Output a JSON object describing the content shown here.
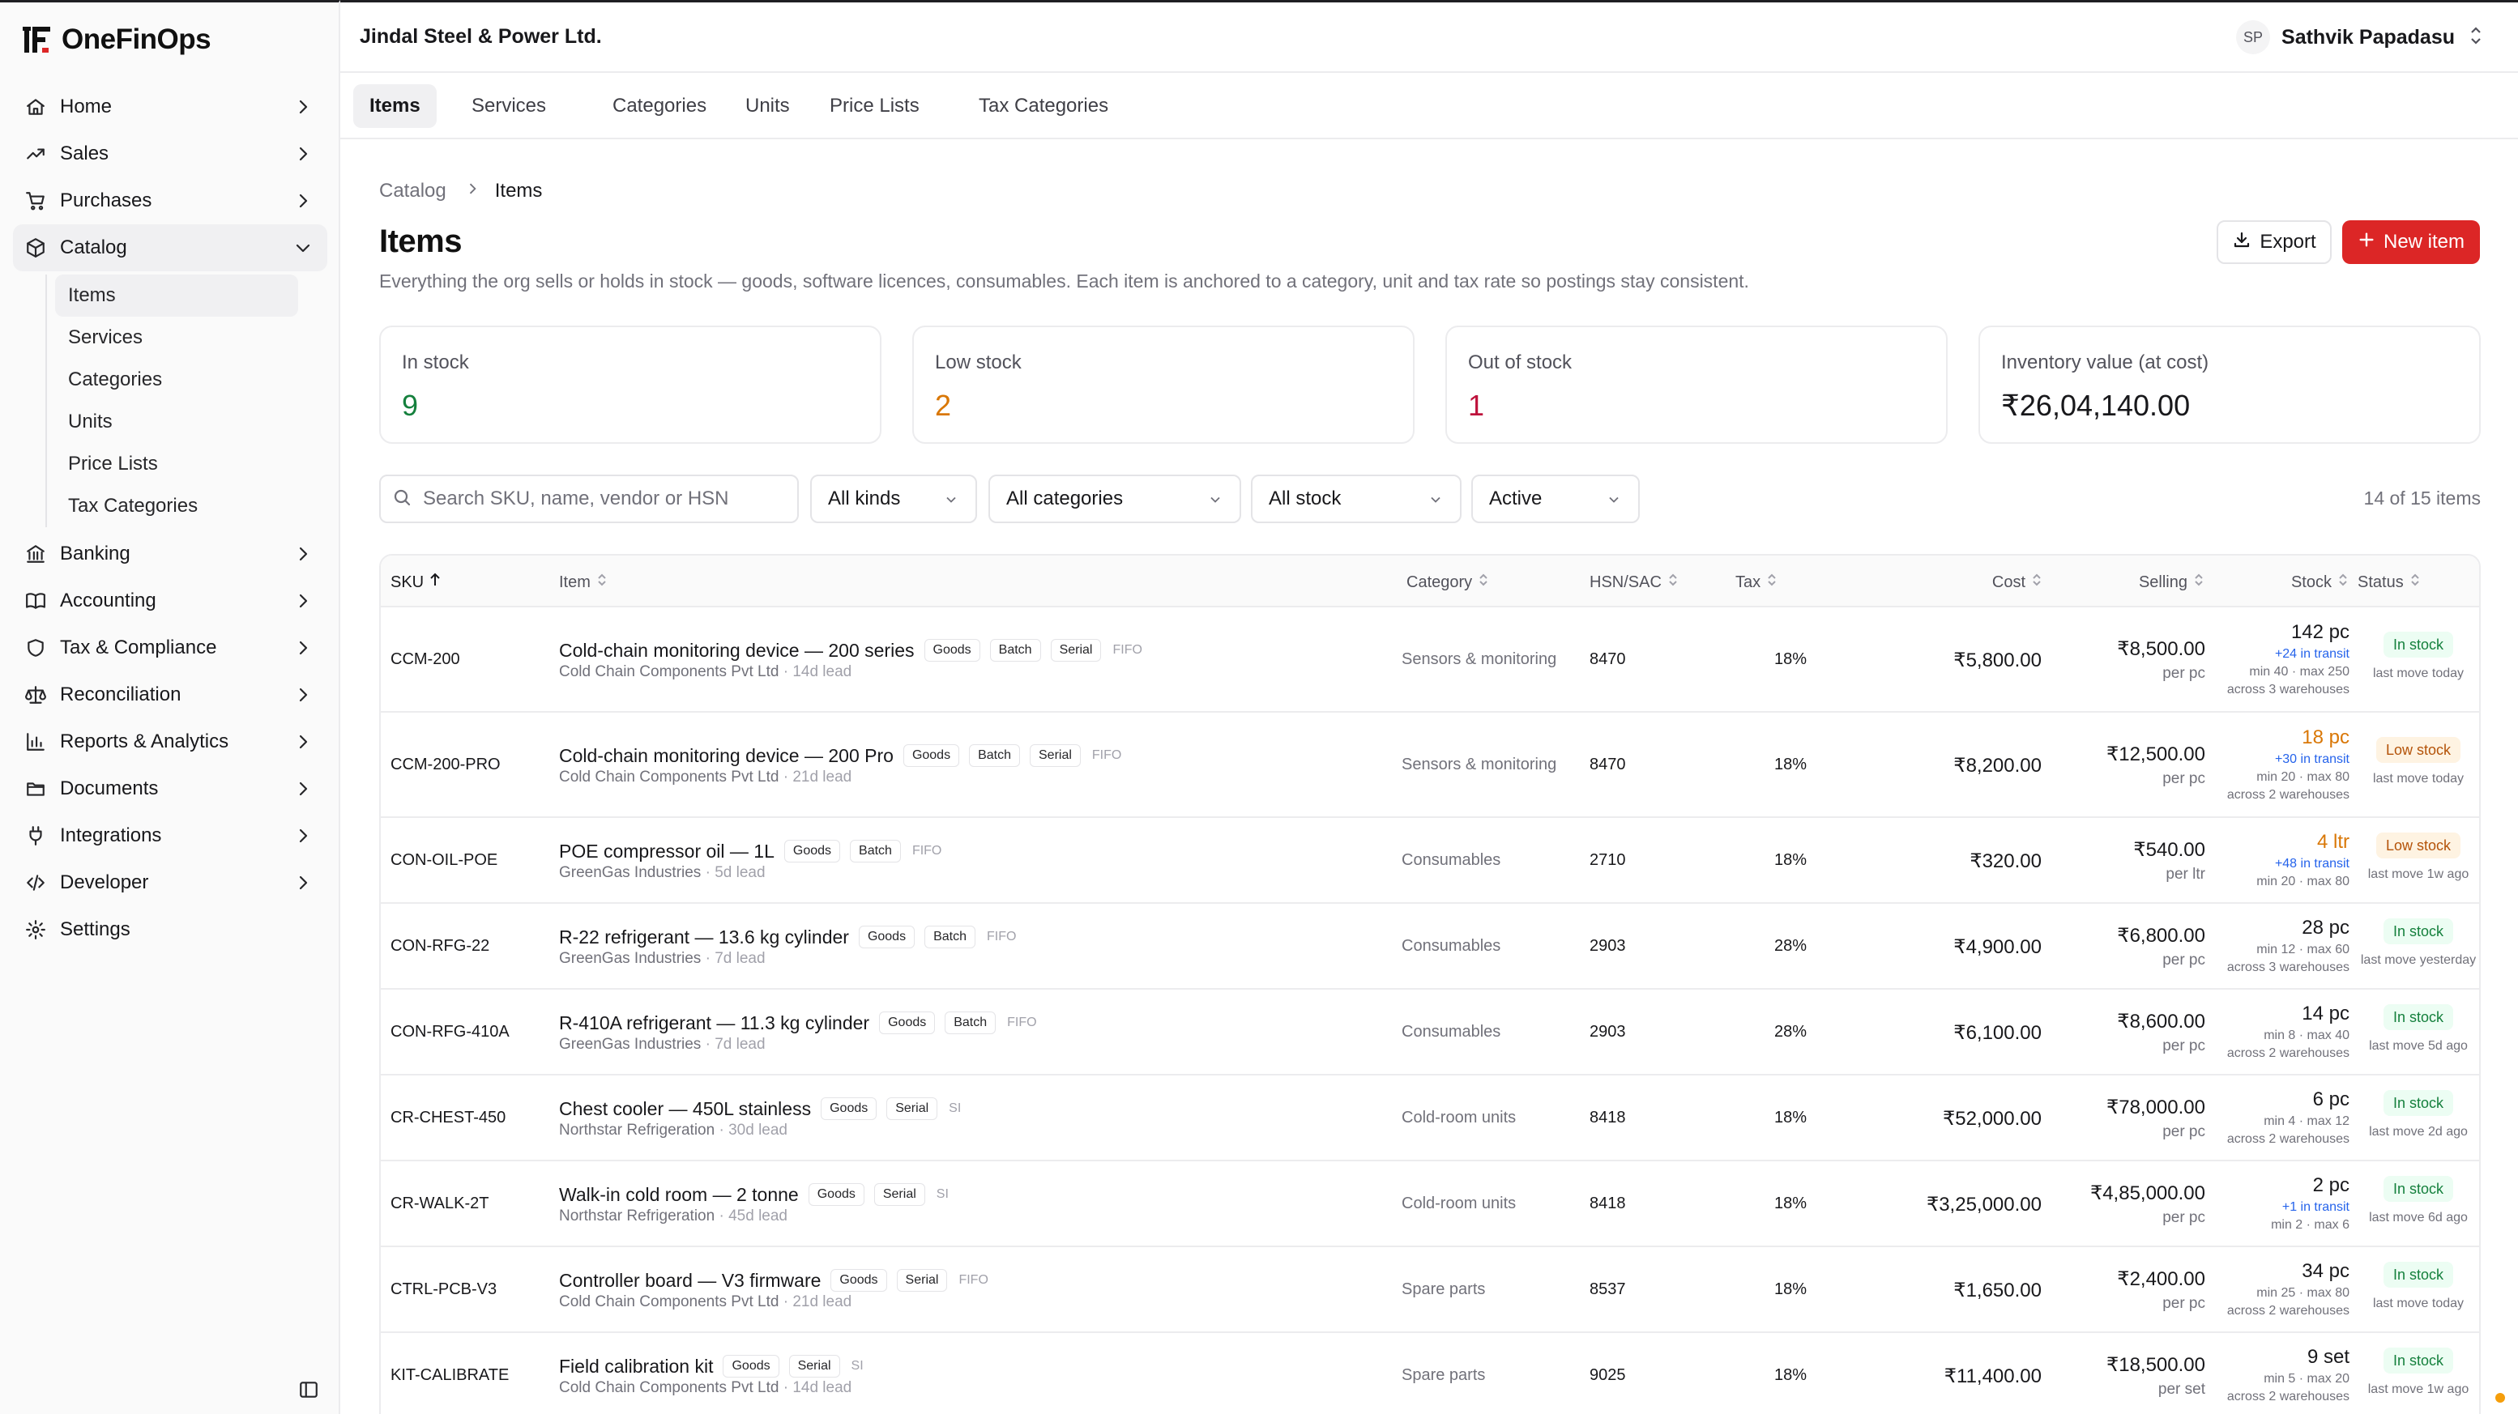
{
  "app": {
    "name": "OneFinOps"
  },
  "topbar": {
    "org": "Jindal Steel & Power Ltd.",
    "user_initials": "SP",
    "user_name": "Sathvik Papadasu"
  },
  "sidebar": {
    "items": [
      {
        "label": "Home",
        "icon": "home-icon"
      },
      {
        "label": "Sales",
        "icon": "trend-icon"
      },
      {
        "label": "Purchases",
        "icon": "cart-icon"
      },
      {
        "label": "Catalog",
        "icon": "box-icon"
      },
      {
        "label": "Banking",
        "icon": "bank-icon"
      },
      {
        "label": "Accounting",
        "icon": "book-icon"
      },
      {
        "label": "Tax & Compliance",
        "icon": "shield-icon"
      },
      {
        "label": "Reconciliation",
        "icon": "scale-icon"
      },
      {
        "label": "Reports & Analytics",
        "icon": "chart-icon"
      },
      {
        "label": "Documents",
        "icon": "folder-icon"
      },
      {
        "label": "Integrations",
        "icon": "plug-icon"
      },
      {
        "label": "Developer",
        "icon": "code-icon"
      },
      {
        "label": "Settings",
        "icon": "gear-icon"
      }
    ],
    "catalog_sub": [
      "Items",
      "Services",
      "Categories",
      "Units",
      "Price Lists",
      "Tax Categories"
    ]
  },
  "tabs": [
    "Items",
    "Services",
    "Categories",
    "Units",
    "Price Lists",
    "Tax Categories"
  ],
  "breadcrumb": {
    "parent": "Catalog",
    "current": "Items"
  },
  "page": {
    "title": "Items",
    "subtitle": "Everything the org sells or holds in stock — goods, software licences, consumables. Each item is anchored to a category, unit and tax rate so postings stay consistent.",
    "export_label": "Export",
    "new_label": "New item"
  },
  "stats": [
    {
      "label": "In stock",
      "value": "9",
      "color": "#15803d"
    },
    {
      "label": "Low stock",
      "value": "2",
      "color": "#d97706"
    },
    {
      "label": "Out of stock",
      "value": "1",
      "color": "#be123c"
    },
    {
      "label": "Inventory value (at cost)",
      "value": "₹26,04,140.00",
      "color": "#18181b"
    }
  ],
  "filters": {
    "search_placeholder": "Search SKU, name, vendor or HSN",
    "kind": "All kinds",
    "category": "All categories",
    "stock": "All stock",
    "status": "Active",
    "count": "14 of 15 items"
  },
  "table": {
    "headers": {
      "sku": "SKU",
      "item": "Item",
      "category": "Category",
      "hsn": "HSN/SAC",
      "tax": "Tax",
      "cost": "Cost",
      "selling": "Selling",
      "stock": "Stock",
      "status": "Status"
    },
    "rows": [
      {
        "sku": "CCM-200",
        "name": "Cold-chain monitoring device — 200 series",
        "tags": [
          "Goods",
          "Batch",
          "Serial"
        ],
        "method": "FIFO",
        "vendor": "Cold Chain Components Pvt Ltd",
        "lead": " · 14d lead",
        "category": "Sensors & monitoring",
        "hsn": "8470",
        "tax": "18%",
        "cost": "₹5,800.00",
        "selling": "₹8,500.00",
        "per": "per pc",
        "stock": "142 pc",
        "stock_level": "in",
        "transit": "+24 in transit",
        "minmax": "min 40 · max 250",
        "warehouses": "across 3 warehouses",
        "status": "In stock",
        "last_move": "last move today"
      },
      {
        "sku": "CCM-200-PRO",
        "name": "Cold-chain monitoring device — 200 Pro",
        "tags": [
          "Goods",
          "Batch",
          "Serial"
        ],
        "method": "FIFO",
        "vendor": "Cold Chain Components Pvt Ltd",
        "lead": " · 21d lead",
        "category": "Sensors & monitoring",
        "hsn": "8470",
        "tax": "18%",
        "cost": "₹8,200.00",
        "selling": "₹12,500.00",
        "per": "per pc",
        "stock": "18 pc",
        "stock_level": "low",
        "transit": "+30 in transit",
        "minmax": "min 20 · max 80",
        "warehouses": "across 2 warehouses",
        "status": "Low stock",
        "last_move": "last move today"
      },
      {
        "sku": "CON-OIL-POE",
        "name": "POE compressor oil — 1L",
        "tags": [
          "Goods",
          "Batch"
        ],
        "method": "FIFO",
        "vendor": "GreenGas Industries",
        "lead": " · 5d lead",
        "category": "Consumables",
        "hsn": "2710",
        "tax": "18%",
        "cost": "₹320.00",
        "selling": "₹540.00",
        "per": "per ltr",
        "stock": "4 ltr",
        "stock_level": "low",
        "transit": "+48 in transit",
        "minmax": "min 20 · max 80",
        "warehouses": "",
        "status": "Low stock",
        "last_move": "last move 1w ago"
      },
      {
        "sku": "CON-RFG-22",
        "name": "R-22 refrigerant — 13.6 kg cylinder",
        "tags": [
          "Goods",
          "Batch"
        ],
        "method": "FIFO",
        "vendor": "GreenGas Industries",
        "lead": " · 7d lead",
        "category": "Consumables",
        "hsn": "2903",
        "tax": "28%",
        "cost": "₹4,900.00",
        "selling": "₹6,800.00",
        "per": "per pc",
        "stock": "28 pc",
        "stock_level": "in",
        "transit": "",
        "minmax": "min 12 · max 60",
        "warehouses": "across 3 warehouses",
        "status": "In stock",
        "last_move": "last move yesterday"
      },
      {
        "sku": "CON-RFG-410A",
        "name": "R-410A refrigerant — 11.3 kg cylinder",
        "tags": [
          "Goods",
          "Batch"
        ],
        "method": "FIFO",
        "vendor": "GreenGas Industries",
        "lead": " · 7d lead",
        "category": "Consumables",
        "hsn": "2903",
        "tax": "28%",
        "cost": "₹6,100.00",
        "selling": "₹8,600.00",
        "per": "per pc",
        "stock": "14 pc",
        "stock_level": "in",
        "transit": "",
        "minmax": "min 8 · max 40",
        "warehouses": "across 2 warehouses",
        "status": "In stock",
        "last_move": "last move 5d ago"
      },
      {
        "sku": "CR-CHEST-450",
        "name": "Chest cooler — 450L stainless",
        "tags": [
          "Goods",
          "Serial"
        ],
        "method": "SI",
        "vendor": "Northstar Refrigeration",
        "lead": " · 30d lead",
        "category": "Cold-room units",
        "hsn": "8418",
        "tax": "18%",
        "cost": "₹52,000.00",
        "selling": "₹78,000.00",
        "per": "per pc",
        "stock": "6 pc",
        "stock_level": "in",
        "transit": "",
        "minmax": "min 4 · max 12",
        "warehouses": "across 2 warehouses",
        "status": "In stock",
        "last_move": "last move 2d ago"
      },
      {
        "sku": "CR-WALK-2T",
        "name": "Walk-in cold room — 2 tonne",
        "tags": [
          "Goods",
          "Serial"
        ],
        "method": "SI",
        "vendor": "Northstar Refrigeration",
        "lead": " · 45d lead",
        "category": "Cold-room units",
        "hsn": "8418",
        "tax": "18%",
        "cost": "₹3,25,000.00",
        "selling": "₹4,85,000.00",
        "per": "per pc",
        "stock": "2 pc",
        "stock_level": "in",
        "transit": "+1 in transit",
        "minmax": "min 2 · max 6",
        "warehouses": "",
        "status": "In stock",
        "last_move": "last move 6d ago"
      },
      {
        "sku": "CTRL-PCB-V3",
        "name": "Controller board — V3 firmware",
        "tags": [
          "Goods",
          "Serial"
        ],
        "method": "FIFO",
        "vendor": "Cold Chain Components Pvt Ltd",
        "lead": " · 21d lead",
        "category": "Spare parts",
        "hsn": "8537",
        "tax": "18%",
        "cost": "₹1,650.00",
        "selling": "₹2,400.00",
        "per": "per pc",
        "stock": "34 pc",
        "stock_level": "in",
        "transit": "",
        "minmax": "min 25 · max 80",
        "warehouses": "across 2 warehouses",
        "status": "In stock",
        "last_move": "last move today"
      },
      {
        "sku": "KIT-CALIBRATE",
        "name": "Field calibration kit",
        "tags": [
          "Goods",
          "Serial"
        ],
        "method": "SI",
        "vendor": "Cold Chain Components Pvt Ltd",
        "lead": " · 14d lead",
        "category": "Spare parts",
        "hsn": "9025",
        "tax": "18%",
        "cost": "₹11,400.00",
        "selling": "₹18,500.00",
        "per": "per set",
        "stock": "9 set",
        "stock_level": "in",
        "transit": "",
        "minmax": "min 5 · max 20",
        "warehouses": "across 2 warehouses",
        "status": "In stock",
        "last_move": "last move 1w ago"
      }
    ]
  }
}
